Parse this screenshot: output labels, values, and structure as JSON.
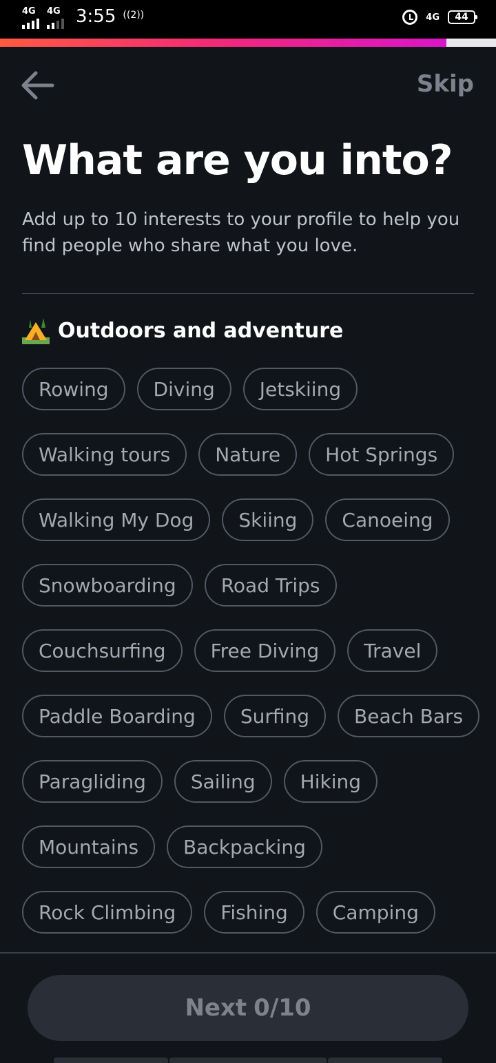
{
  "status_bar": {
    "network1": "4G",
    "network2": "4G",
    "time": "3:55",
    "hotspot": "((2))",
    "lte": "4G",
    "battery": "44"
  },
  "progress": {
    "fraction": 0.9,
    "fill_colors": [
      "#fd5a42",
      "#f2287a",
      "#d916c8"
    ]
  },
  "header": {
    "back_icon": "arrow-left-icon",
    "skip_label": "Skip"
  },
  "title": "What are you into?",
  "subtitle": "Add up to 10 interests to your profile to help you find people who share what you love.",
  "section": {
    "icon": "camping-tent-icon",
    "title": "Outdoors and adventure",
    "rows": [
      [
        "Rowing",
        "Diving",
        "Jetskiing"
      ],
      [
        "Walking tours",
        "Nature",
        "Hot Springs"
      ],
      [
        "Walking My Dog",
        "Skiing",
        "Canoeing"
      ],
      [
        "Snowboarding",
        "Road Trips"
      ],
      [
        "Couchsurfing",
        "Free Diving",
        "Travel"
      ],
      [
        "Paddle Boarding",
        "Surfing",
        "Beach Bars"
      ],
      [
        "Paragliding",
        "Sailing",
        "Hiking"
      ],
      [
        "Mountains",
        "Backpacking"
      ],
      [
        "Rock Climbing",
        "Fishing",
        "Camping"
      ]
    ]
  },
  "next_button": {
    "label": "Next",
    "count": "0/10"
  }
}
